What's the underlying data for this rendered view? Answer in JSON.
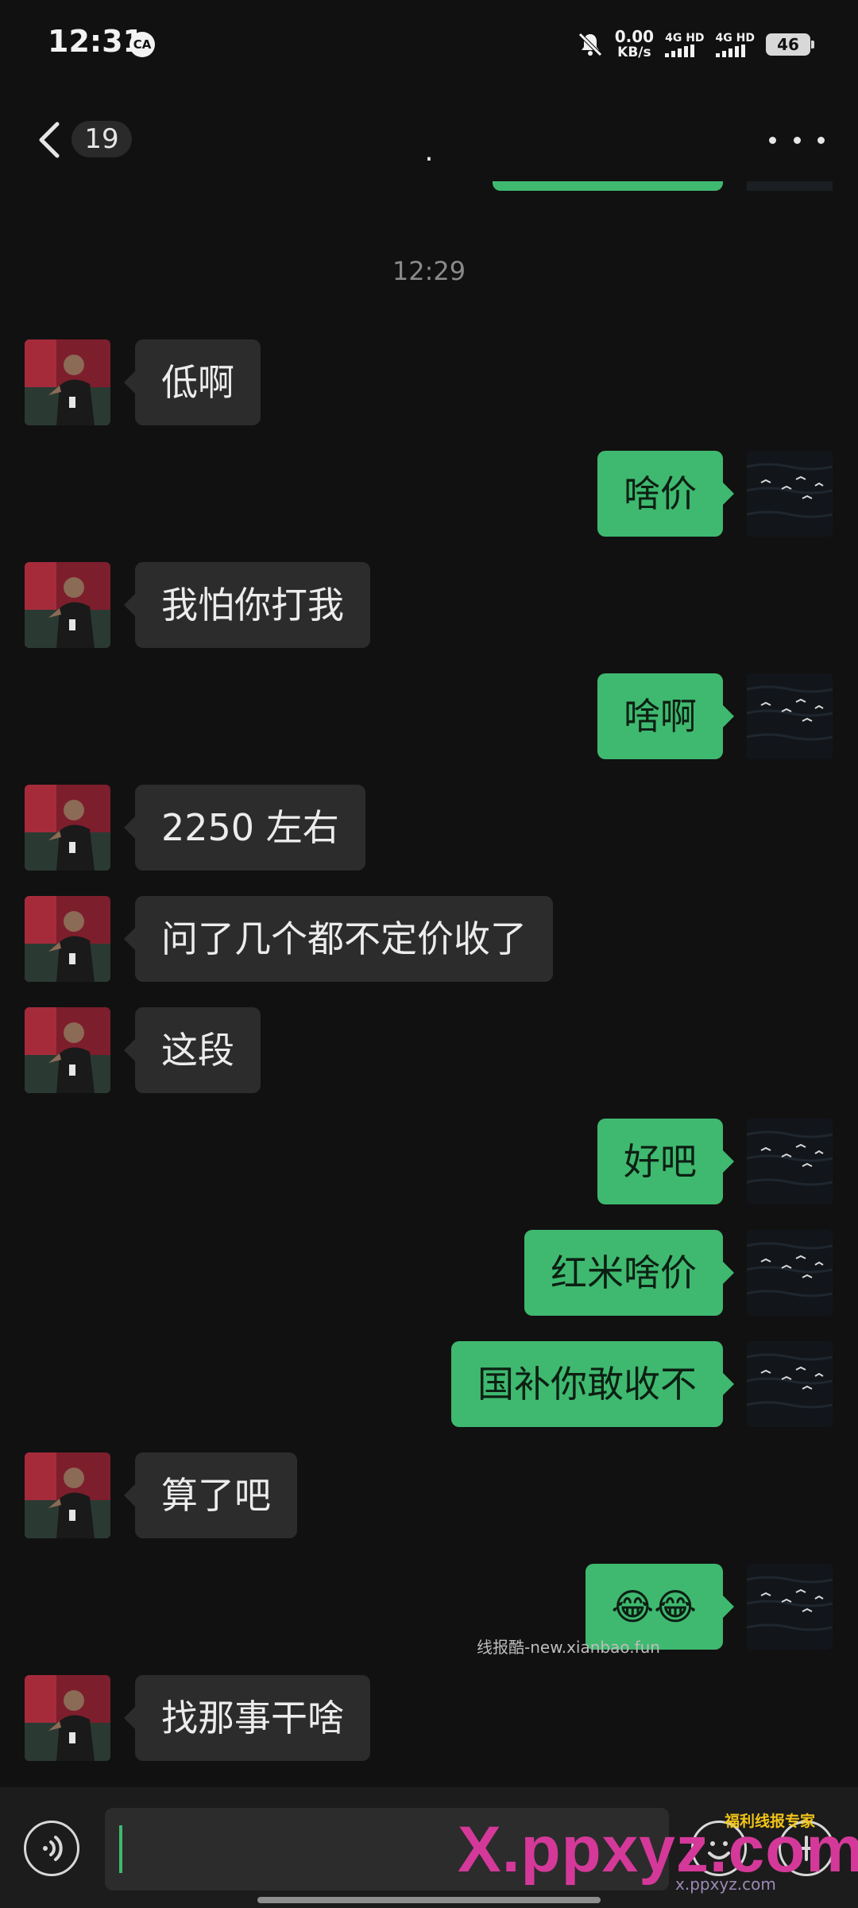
{
  "status_bar": {
    "time": "12:31",
    "indicator_badge": "CA",
    "net_speed_value": "0.00",
    "net_speed_unit": "KB/s",
    "sim1_label": "4G HD",
    "sim2_label": "4G HD",
    "battery": "46",
    "icons": [
      "mute-bell-icon",
      "signal-icon",
      "battery-icon"
    ]
  },
  "header": {
    "unread_count": "19",
    "title": "."
  },
  "timestamp": "12:29",
  "messages": [
    {
      "direction": "in",
      "text": "低啊"
    },
    {
      "direction": "out",
      "text": "啥价"
    },
    {
      "direction": "in",
      "text": "我怕你打我"
    },
    {
      "direction": "out",
      "text": "啥啊"
    },
    {
      "direction": "in",
      "text": "2250 左右"
    },
    {
      "direction": "in",
      "text": "问了几个都不定价收了"
    },
    {
      "direction": "in",
      "text": "这段"
    },
    {
      "direction": "out",
      "text": "好吧"
    },
    {
      "direction": "out",
      "text": "红米啥价"
    },
    {
      "direction": "out",
      "text": "国补你敢收不"
    },
    {
      "direction": "in",
      "text": "算了吧"
    },
    {
      "direction": "out",
      "text": "😂😂"
    },
    {
      "direction": "in",
      "text": "找那事干啥"
    }
  ],
  "watermark": {
    "line": "线报酷-new.xianbao.fun",
    "logo": "X.ppxyz.com",
    "logo_top": "福利线报专家",
    "logo_sub": "x.ppxyz.com"
  },
  "colors": {
    "background": "#111111",
    "incoming_bubble": "#2c2c2c",
    "outgoing_bubble": "#3fb96f"
  }
}
